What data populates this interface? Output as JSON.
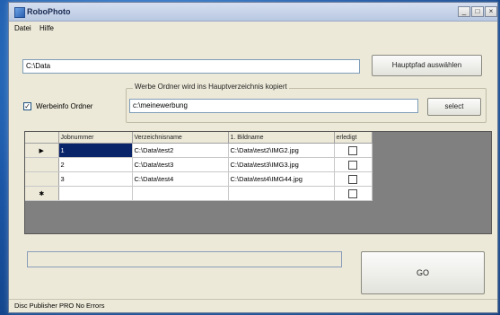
{
  "window": {
    "title": "RoboPhoto",
    "minimize": "_",
    "maximize": "□",
    "close": "×"
  },
  "menu": {
    "file": "Datei",
    "help": "Hilfe"
  },
  "main_path": {
    "value": "C:\\Data",
    "button": "Hauptpfad auswählen"
  },
  "ad_info": {
    "checkbox_label": "Werbeinfo Ordner",
    "checked": true,
    "group_title": "Werbe Ordner wird ins Hauptverzeichnis kopiert",
    "path_value": "c:\\meinewerbung",
    "select_button": "select"
  },
  "grid": {
    "columns": [
      "Jobnummer",
      "Verzeichnisname",
      "1. Bildname",
      "erledigt"
    ],
    "rows": [
      {
        "job": "1",
        "dir": "C:\\Data\\test2",
        "image": "C:\\Data\\test2\\IMG2.jpg",
        "done": false
      },
      {
        "job": "2",
        "dir": "C:\\Data\\test3",
        "image": "C:\\Data\\test3\\IMG3.jpg",
        "done": false
      },
      {
        "job": "3",
        "dir": "C:\\Data\\test4",
        "image": "C:\\Data\\test4\\IMG44.jpg",
        "done": false
      }
    ],
    "current_marker": "▶",
    "new_row_marker": "✱"
  },
  "progress": {
    "value": 0
  },
  "go_button": "GO",
  "status": "Disc Publisher PRO  No Errors",
  "colors": {
    "selection": "#0a246a",
    "grid_background": "#808080",
    "window": "#ece9d8"
  }
}
